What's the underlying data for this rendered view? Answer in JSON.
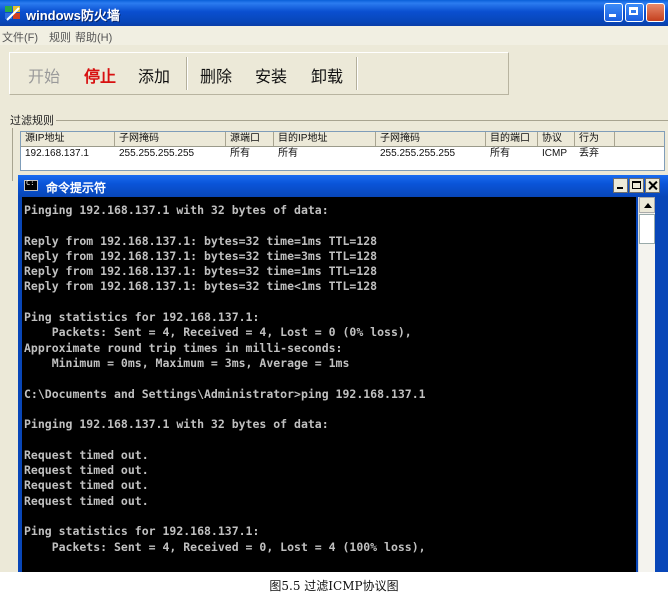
{
  "firewall": {
    "title": "windows防火墙",
    "menu": [
      "文件(F)",
      "规则",
      "帮助(H)"
    ],
    "toolbar": {
      "start": "开始",
      "stop": "停止",
      "add": "添加",
      "delete": "删除",
      "install": "安装",
      "uninstall": "卸载"
    },
    "rules_group_title": "过滤规则",
    "rules_table": {
      "headers": [
        "源IP地址",
        "子网掩码",
        "源端口",
        "目的IP地址",
        "子网掩码",
        "目的端口",
        "协议",
        "行为"
      ],
      "rows": [
        [
          "192.168.137.1",
          "255.255.255.255",
          "所有",
          "所有",
          "255.255.255.255",
          "所有",
          "ICMP",
          "丢弃"
        ]
      ]
    }
  },
  "cmd": {
    "title": "命令提示符",
    "lines": [
      "Pinging 192.168.137.1 with 32 bytes of data:",
      "",
      "Reply from 192.168.137.1: bytes=32 time=1ms TTL=128",
      "Reply from 192.168.137.1: bytes=32 time=3ms TTL=128",
      "Reply from 192.168.137.1: bytes=32 time=1ms TTL=128",
      "Reply from 192.168.137.1: bytes=32 time<1ms TTL=128",
      "",
      "Ping statistics for 192.168.137.1:",
      "    Packets: Sent = 4, Received = 4, Lost = 0 (0% loss),",
      "Approximate round trip times in milli-seconds:",
      "    Minimum = 0ms, Maximum = 3ms, Average = 1ms",
      "",
      "C:\\Documents and Settings\\Administrator>ping 192.168.137.1",
      "",
      "Pinging 192.168.137.1 with 32 bytes of data:",
      "",
      "Request timed out.",
      "Request timed out.",
      "Request timed out.",
      "Request timed out.",
      "",
      "Ping statistics for 192.168.137.1:",
      "    Packets: Sent = 4, Received = 0, Lost = 4 (100% loss),"
    ]
  },
  "caption": "图5.5  过滤ICMP协议图"
}
